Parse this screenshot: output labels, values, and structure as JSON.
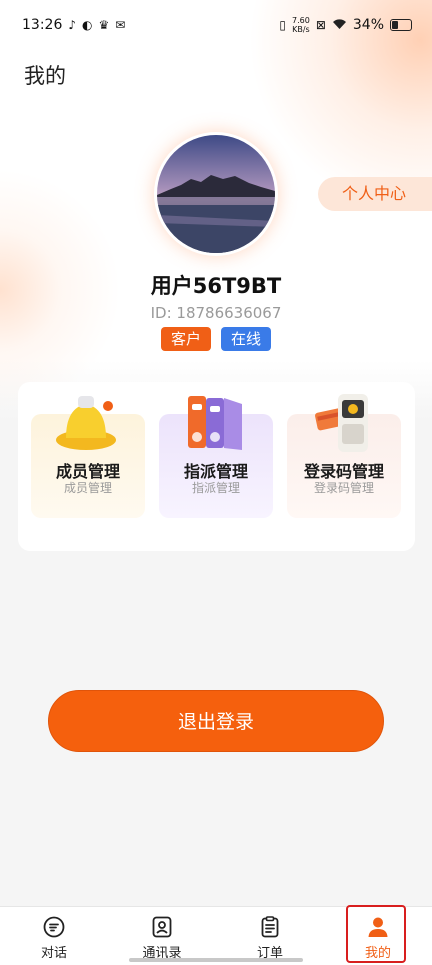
{
  "status_bar": {
    "time": "13:26",
    "net_speed_value": "7.60",
    "net_speed_unit": "KB/s",
    "battery": "34%",
    "battery_level": 0.34
  },
  "page_title": "我的",
  "personal_center_label": "个人中心",
  "user": {
    "name": "用户56T9BT",
    "id_text": "ID: 18786636067",
    "role_tag": "客户",
    "status_tag": "在线"
  },
  "functions": [
    {
      "title": "成员管理",
      "subtitle": "成员管理",
      "icon": "bell-icon"
    },
    {
      "title": "指派管理",
      "subtitle": "指派管理",
      "icon": "folders-icon"
    },
    {
      "title": "登录码管理",
      "subtitle": "登录码管理",
      "icon": "card-terminal-icon"
    }
  ],
  "logout_label": "退出登录",
  "tabs": [
    {
      "label": "对话",
      "icon": "chat-icon",
      "active": false
    },
    {
      "label": "通讯录",
      "icon": "contacts-icon",
      "active": false
    },
    {
      "label": "订单",
      "icon": "order-icon",
      "active": false
    },
    {
      "label": "我的",
      "icon": "person-icon",
      "active": true
    }
  ],
  "colors": {
    "accent": "#f05f16",
    "online_blue": "#3a7be8",
    "highlight_red": "#d81e1e"
  }
}
